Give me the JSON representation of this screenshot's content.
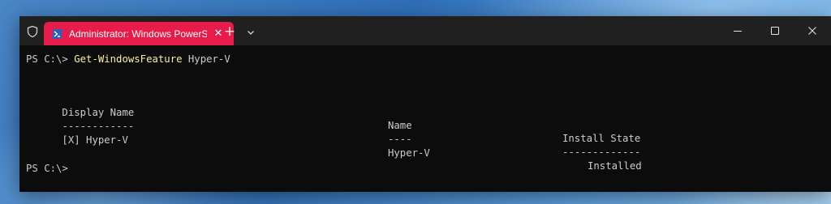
{
  "window": {
    "tab_title": "Administrator: Windows PowerShell",
    "tab_close_glyph": "✕",
    "new_tab_glyph": "+",
    "icons": [
      "shield-icon",
      "powershell-icon",
      "close-icon",
      "plus-icon",
      "chevron-down-icon",
      "minimize-icon",
      "maximize-icon",
      "close-window-icon"
    ],
    "accent_color": "#e81c4a",
    "titlebar_color": "#202020",
    "terminal_background": "#0c0c0c"
  },
  "terminal": {
    "prompt": "PS C:\\> ",
    "command": "Get-WindowsFeature",
    "argument": " Hyper-V",
    "table": {
      "headers": [
        "Display Name",
        "Name",
        "Install State"
      ],
      "separators": [
        "------------",
        "----",
        "-------------"
      ],
      "rows": [
        [
          "[X] Hyper-V",
          "Hyper-V",
          "Installed"
        ]
      ]
    },
    "final_prompt": "PS C:\\>",
    "text_color": "#cccccc",
    "command_color": "#f9f1a5"
  }
}
